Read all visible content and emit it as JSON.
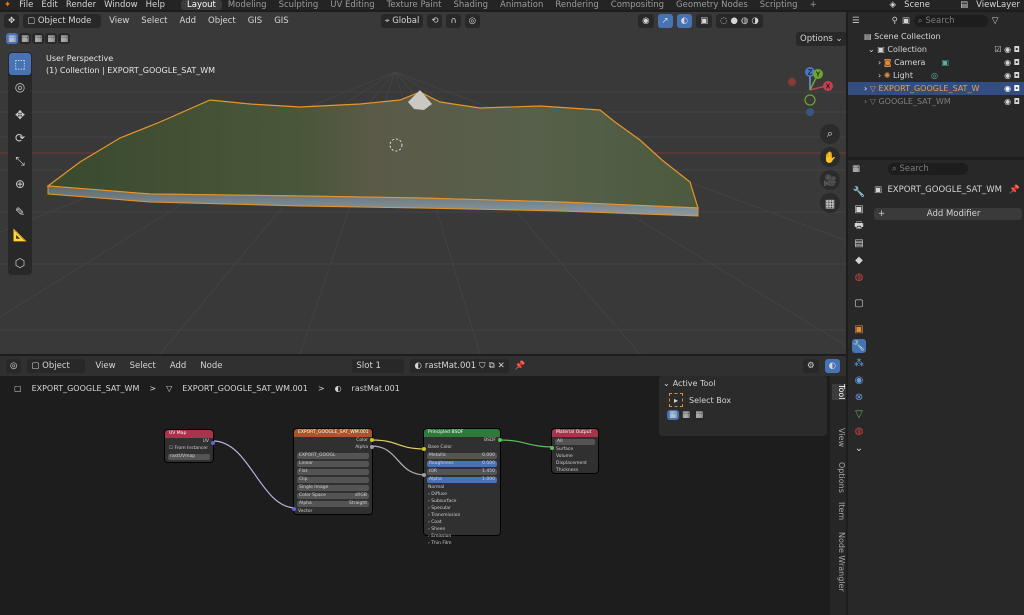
{
  "menus": [
    "File",
    "Edit",
    "Render",
    "Window",
    "Help"
  ],
  "workspaces": [
    "Layout",
    "Modeling",
    "Sculpting",
    "UV Editing",
    "Texture Paint",
    "Shading",
    "Animation",
    "Rendering",
    "Compositing",
    "Geometry Nodes",
    "Scripting"
  ],
  "workspace_add": "+",
  "scene": {
    "label": "Scene",
    "view_layer": "ViewLayer"
  },
  "viewport": {
    "mode": "Object Mode",
    "menus": [
      "View",
      "Select",
      "Add",
      "Object",
      "GIS",
      "GIS"
    ],
    "orientation": "Global",
    "options_label": "Options",
    "overlay_title": "User Perspective",
    "overlay_subtitle": "(1) Collection | EXPORT_GOOGLE_SAT_WM",
    "gizmo": {
      "x": "X",
      "y": "Y",
      "z": "Z"
    }
  },
  "outliner": {
    "search_placeholder": "Search",
    "root": "Scene Collection",
    "collection": "Collection",
    "items": [
      {
        "name": "Camera"
      },
      {
        "name": "Light"
      },
      {
        "name": "EXPORT_GOOGLE_SAT_W"
      },
      {
        "name": "GOOGLE_SAT_WM"
      }
    ]
  },
  "properties": {
    "search_placeholder": "Search",
    "object_name": "EXPORT_GOOGLE_SAT_WM",
    "add_modifier": "Add Modifier"
  },
  "node_editor": {
    "type": "Object",
    "menus": [
      "View",
      "Select",
      "Add",
      "Node"
    ],
    "slot": "Slot 1",
    "material": "rastMat.001",
    "breadcrumb": [
      "EXPORT_GOOGLE_SAT_WM",
      "EXPORT_GOOGLE_SAT_WM.001",
      "rastMat.001"
    ],
    "breadcrumb_sep": ">",
    "active_tool_title": "Active Tool",
    "active_tool_name": "Select Box",
    "side_tabs": [
      "Tool",
      "View",
      "Options",
      "Item",
      "Node Wrangler"
    ],
    "nodes": {
      "uvmap": {
        "title": "UV Map",
        "out": "UV",
        "field1": "From Instancer",
        "field2": "rastUVmap"
      },
      "image": {
        "title": "EXPORT_GOOGLE_SAT_WM.001",
        "out1": "Color",
        "out2": "Alpha",
        "file": "EXPORT_GOOGL",
        "opts": [
          "Linear",
          "Flat",
          "Clip",
          "Single Image"
        ],
        "colorspace_label": "Color Space",
        "colorspace": "sRGB",
        "alpha_label": "Alpha",
        "alpha": "Straight",
        "vector": "Vector"
      },
      "bsdf": {
        "title": "Principled BSDF",
        "out": "BSDF",
        "base_color": "Base Color",
        "fields": [
          {
            "k": "Metallic",
            "v": "0.000"
          },
          {
            "k": "Roughness",
            "v": "0.500"
          },
          {
            "k": "IOR",
            "v": "1.450"
          },
          {
            "k": "Alpha",
            "v": "1.000"
          }
        ],
        "normal": "Normal",
        "sections": [
          "Diffuse",
          "Subsurface",
          "Specular",
          "Transmission",
          "Coat",
          "Sheen",
          "Emission",
          "Thin Film"
        ]
      },
      "output": {
        "title": "Material Output",
        "target": "All",
        "sockets": [
          "Surface",
          "Volume",
          "Displacement",
          "Thickness"
        ]
      }
    }
  }
}
